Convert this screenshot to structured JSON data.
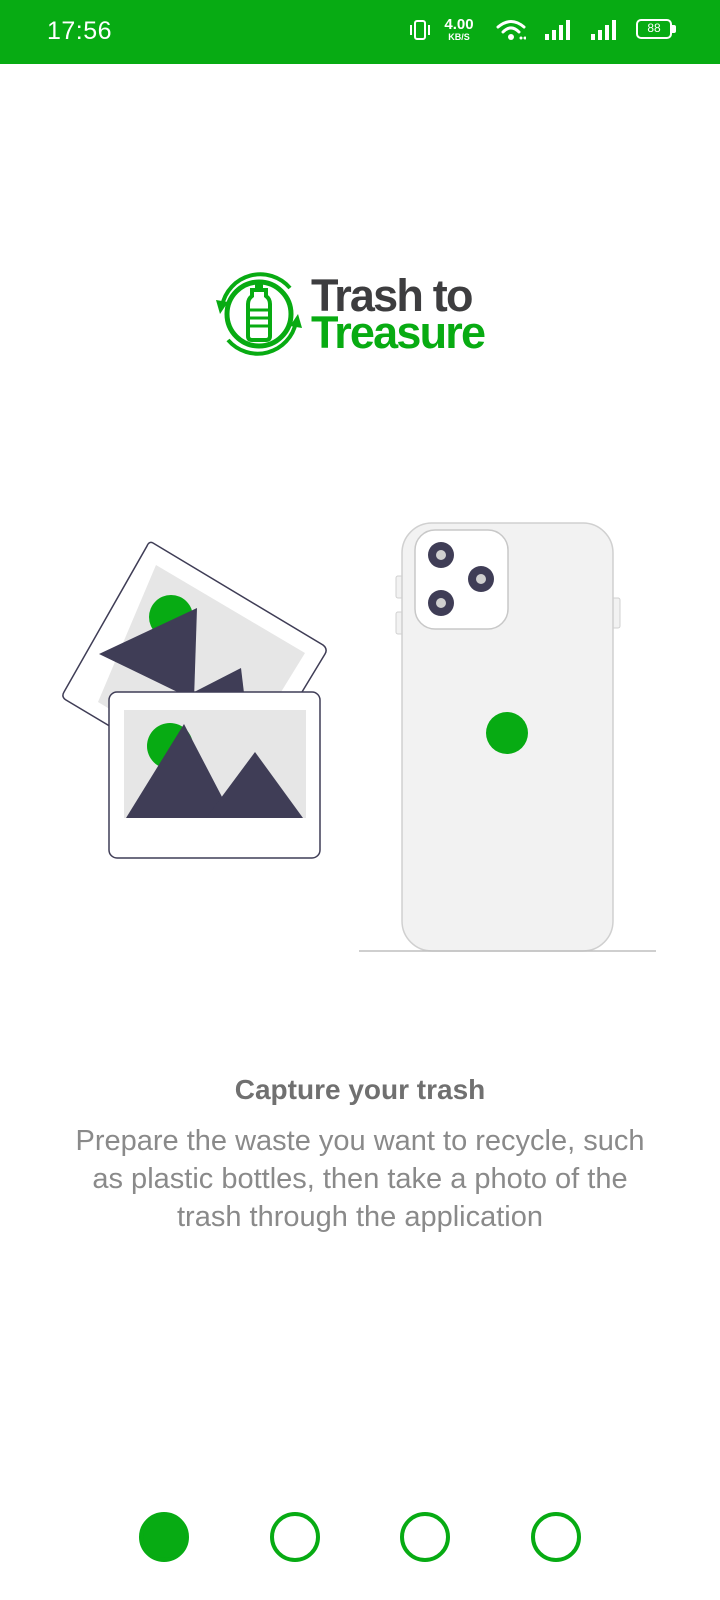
{
  "status_bar": {
    "time": "17:56",
    "net_speed_value": "4.00",
    "net_speed_unit": "KB/S",
    "battery_level": "88",
    "icons": [
      "vibrate-icon",
      "wifi-icon",
      "signal-icon",
      "signal-icon",
      "battery-icon"
    ]
  },
  "logo": {
    "line1": "Trash to",
    "line2": "Treasure",
    "icon": "recycle-bottle-icon"
  },
  "onboarding": {
    "title": "Capture your trash",
    "description": "Prepare the waste you want to recycle, such as plastic bottles, then take a photo of the trash through the application"
  },
  "page_indicator": {
    "total": 4,
    "active_index": 0
  },
  "colors": {
    "brand_green": "#07ab13",
    "logo_dark": "#3d3d3f",
    "illustration_dark": "#3f3d56",
    "text_gray": "#8a8a8a"
  }
}
